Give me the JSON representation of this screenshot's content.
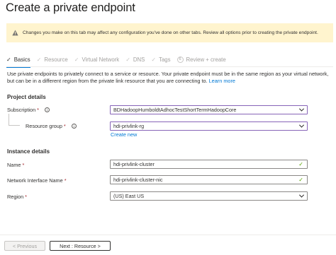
{
  "header": {
    "title": "Create a private endpoint",
    "more": "···"
  },
  "warning": {
    "text": "Changes you make on this tab may affect any configuration you've done on other tabs. Review all options prior to creating the private endpoint."
  },
  "tabs": [
    {
      "label": "Basics",
      "state": "active"
    },
    {
      "label": "Resource",
      "state": "disabled"
    },
    {
      "label": "Virtual Network",
      "state": "disabled"
    },
    {
      "label": "DNS",
      "state": "disabled"
    },
    {
      "label": "Tags",
      "state": "disabled"
    },
    {
      "label": "Review + create",
      "step": "6",
      "state": "disabled"
    }
  ],
  "description": {
    "text": "Use private endpoints to privately connect to a service or resource. Your private endpoint must be in the same region as your virtual network, but can be in a different region from the private link resource that you are connecting to.",
    "link": "Learn more"
  },
  "project": {
    "heading": "Project details",
    "subscription_label": "Subscription",
    "subscription_value": "BDHadoopHumboldtAdhocTestShortTermHadoopCore",
    "resource_group_label": "Resource group",
    "resource_group_value": "hdi-privlink-rg",
    "create_new": "Create new"
  },
  "instance": {
    "heading": "Instance details",
    "name_label": "Name",
    "name_value": "hdi-privlink-cluster",
    "nic_label": "Network Interface Name",
    "nic_value": "hdi-privlink-cluster-nic",
    "region_label": "Region",
    "region_value": "(US) East US"
  },
  "footer": {
    "previous": "< Previous",
    "next": "Next : Resource >"
  },
  "colors": {
    "accent": "#0078d4",
    "warning_bg": "#fff4ce",
    "focus_border": "#8764b8",
    "valid": "#57a300",
    "required": "#a4262c"
  }
}
